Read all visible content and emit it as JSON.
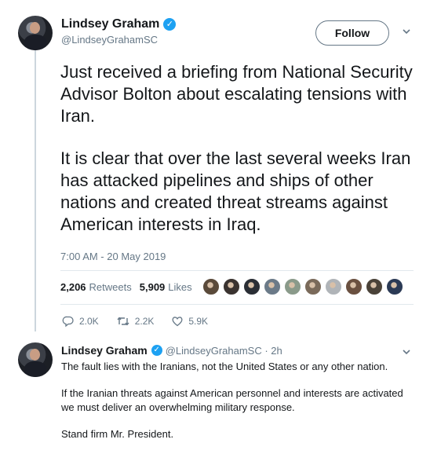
{
  "tweet": {
    "author_name": "Lindsey Graham",
    "handle": "@LindseyGrahamSC",
    "follow_label": "Follow",
    "paragraphs": [
      "Just received a briefing from National Security Advisor Bolton about escalating tensions with Iran.",
      "It is clear that over the last several weeks Iran has attacked pipelines and ships of other nations and created threat streams against American interests in Iraq."
    ],
    "timestamp": "7:00 AM - 20 May 2019",
    "retweets_count": "2,206",
    "retweets_label": "Retweets",
    "likes_count": "5,909",
    "likes_label": "Likes",
    "reply_count": "2.0K",
    "retweet_action_count": "2.2K",
    "like_action_count": "5.9K"
  },
  "likers": [
    "#5a4a3a",
    "#3a3330",
    "#2a2e35",
    "#6b7a88",
    "#8a9a8a",
    "#7a6a5a",
    "#b0b4b8",
    "#6a5040",
    "#4a4238",
    "#2b3a55"
  ],
  "reply": {
    "author_name": "Lindsey Graham",
    "handle_time": "@LindseyGrahamSC · 2h",
    "paragraphs": [
      "The fault lies with the Iranians, not the United States or any other nation.",
      "If the Iranian threats against American personnel and interests are activated we must deliver an overwhelming military response.",
      "Stand firm Mr. President."
    ]
  },
  "colors": {
    "accent": "#1da1f2",
    "muted": "#657786",
    "border": "#e1e8ed"
  },
  "icons": [
    "verified-badge-icon",
    "chevron-down-icon",
    "reply-icon",
    "retweet-icon",
    "like-icon"
  ]
}
